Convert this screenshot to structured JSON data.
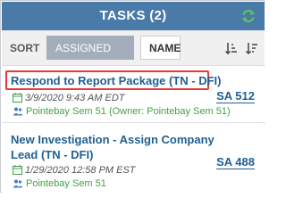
{
  "header": {
    "title": "TASKS (2)",
    "refresh_icon": "refresh-icon"
  },
  "toolbar": {
    "sort_label": "SORT",
    "sort_options": [
      "ASSIGNED DATE",
      "NAME"
    ],
    "selected_sort": "ASSIGNED DATE",
    "sort_ascending_icon": "sort-ascending-icon",
    "sort_descending_icon": "sort-descending-icon"
  },
  "tasks": [
    {
      "title": "Respond to Report Package (TN - DFI)",
      "date": "3/9/2020 9:43 AM EDT",
      "owner": "Pointebay Sem 51 (Owner: Pointebay Sem 51)",
      "id": "SA 512",
      "highlighted": true
    },
    {
      "title": "New Investigation - Assign Company Lead (TN - DFI)",
      "date": "1/29/2020 12:58 PM EST",
      "owner": "Pointebay Sem 51",
      "id": "SA 488",
      "highlighted": false
    }
  ],
  "colors": {
    "header_bg": "#4a7aa8",
    "link": "#1f5f94",
    "owner_green": "#43a047",
    "highlight_red": "#e53935",
    "selected_sort_bg": "#a4aebb"
  }
}
